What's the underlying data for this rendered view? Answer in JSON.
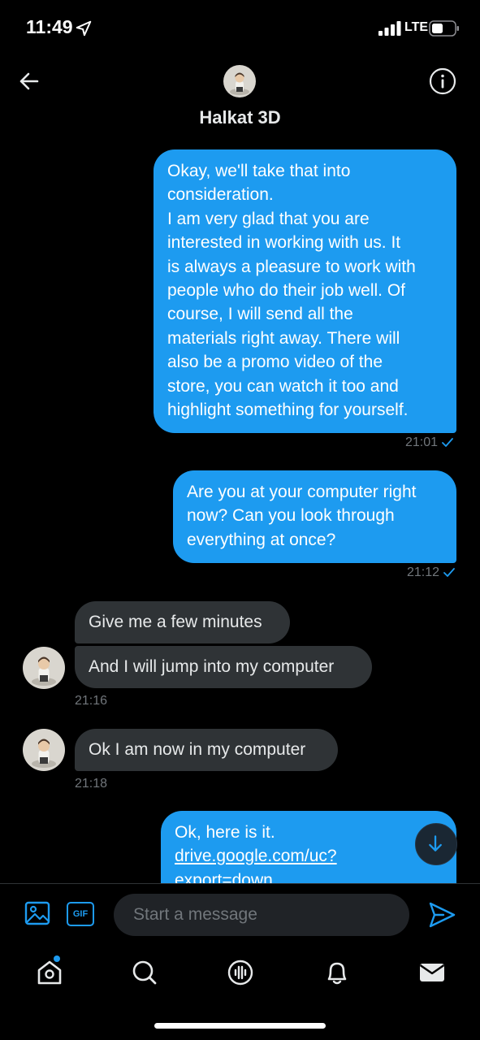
{
  "status_bar": {
    "time": "11:49",
    "network": "LTE",
    "icons": [
      "location-arrow-icon",
      "signal-bars-icon",
      "battery-icon"
    ]
  },
  "header": {
    "contact_name": "Halkat 3D",
    "back_icon": "arrow-left-icon",
    "info_icon": "info-circle-icon"
  },
  "messages": [
    {
      "direction": "outgoing",
      "lines": [
        "Okay, we'll take that into",
        "consideration.",
        "I am very glad that you are",
        "interested in working with us. It",
        "is always a pleasure to work with",
        "people who do their job well. Of",
        "course, I will send all the",
        "materials right away. There will",
        "also be a promo video of the",
        "store, you can watch it too and",
        "highlight something for yourself."
      ],
      "time": "21:01",
      "read": true
    },
    {
      "direction": "outgoing",
      "lines": [
        "Are you at your computer right",
        "now? Can you look through",
        "everything at once?"
      ],
      "time": "21:12",
      "read": true
    },
    {
      "direction": "incoming",
      "lines": [
        "Give me a few minutes"
      ]
    },
    {
      "direction": "incoming",
      "lines": [
        "And I will jump into my computer"
      ],
      "time": "21:16"
    },
    {
      "direction": "incoming",
      "lines": [
        "Ok I am now in my computer"
      ],
      "time": "21:18"
    },
    {
      "direction": "outgoing",
      "lines": [
        "Ok, here is it."
      ],
      "link_lines": [
        "drive.google.com/uc?",
        "export=down"
      ]
    }
  ],
  "composer": {
    "placeholder": "Start a message",
    "gif_label": "GIF",
    "icons": [
      "image-icon",
      "gif-icon",
      "send-icon"
    ]
  },
  "tab_bar": {
    "tabs": [
      "home-icon",
      "search-icon",
      "spaces-icon",
      "notifications-icon",
      "messages-icon"
    ],
    "home_has_notification": true
  },
  "colors": {
    "accent": "#1d9bf0",
    "background": "#000000",
    "incoming_bubble": "#2f3336",
    "muted_text": "#71767b"
  }
}
